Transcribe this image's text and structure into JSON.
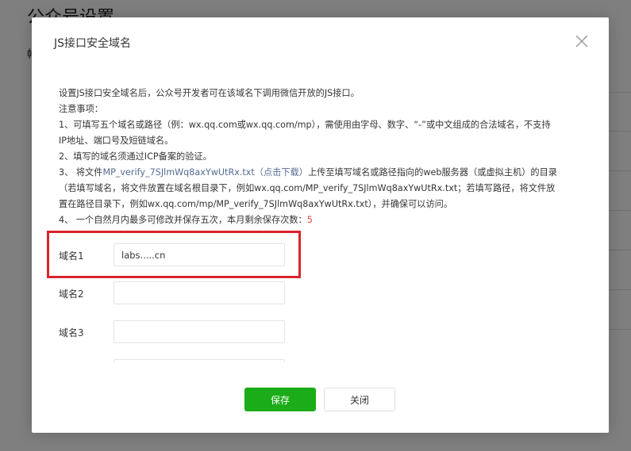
{
  "background": {
    "page_title": "公众号设置",
    "tab_fragment": "帐"
  },
  "dialog": {
    "title": "JS接口安全域名",
    "intro": "设置JS接口安全域名后，公众号开发者可在该域名下调用微信开放的JS接口。",
    "notice_heading": "注意事项：",
    "note1_line1": "1、可填写五个域名或路径（例：wx.qq.com或wx.qq.com/mp），需使用由字母、数字、“-”或中文组成的合法域名，不支持",
    "note1_line2": "IP地址、端口号及短链域名。",
    "note2": "2、填写的域名须通过ICP备案的验证。",
    "note3_prefix": "3、 将文件",
    "note3_file": "MP_verify_7SJlmWq8axYwUtRx.txt",
    "note3_download": "（点击下载）",
    "note3_suffix": "上传至填写域名或路径指向的web服务器（或虚拟主机）的目录",
    "note3_line2": "（若填写域名，将文件放置在域名根目录下，例如wx.qq.com/MP_verify_7SJlmWq8axYwUtRx.txt；若填写路径，将文件放",
    "note3_line3": "置在路径目录下，例如wx.qq.com/mp/MP_verify_7SJlmWq8axYwUtRx.txt），并确保可以访问。",
    "note4_prefix": "4、 一个自然月内最多可修改并保存五次，本月剩余保存次数：",
    "note4_remaining": "5",
    "fields": [
      {
        "label": "域名1",
        "value": "labs.....cn"
      },
      {
        "label": "域名2",
        "value": ""
      },
      {
        "label": "域名3",
        "value": ""
      }
    ],
    "save_label": "保存",
    "close_label": "关闭"
  },
  "colors": {
    "primary_green": "#1aad19",
    "link_blue": "#576b95",
    "remaining_red": "#e64340",
    "highlight_red": "#d9242a"
  }
}
